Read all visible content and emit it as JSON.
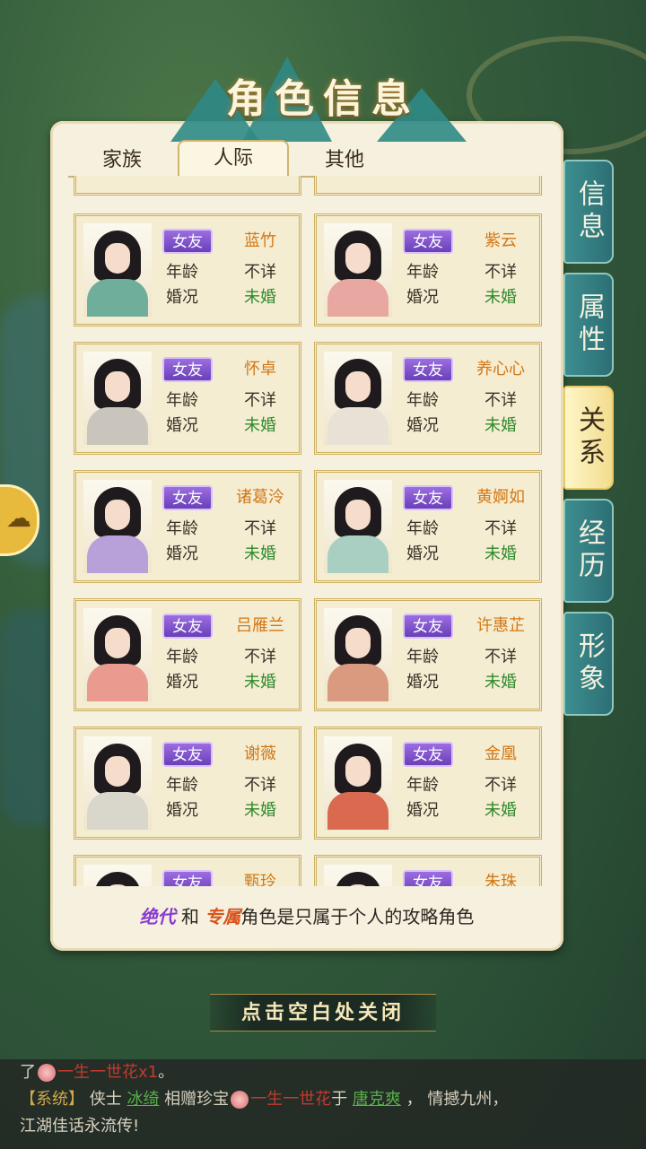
{
  "window": {
    "title": "角色信息"
  },
  "tabs": [
    {
      "label": "家族",
      "active": false
    },
    {
      "label": "人际",
      "active": true
    },
    {
      "label": "其他",
      "active": false
    }
  ],
  "side_tabs": [
    {
      "label": "信息",
      "active": false
    },
    {
      "label": "属性",
      "active": false
    },
    {
      "label": "关系",
      "active": true
    },
    {
      "label": "经历",
      "active": false
    },
    {
      "label": "形象",
      "active": false
    }
  ],
  "field_labels": {
    "age": "年龄",
    "marital": "婚况"
  },
  "characters": [
    {
      "relation": "女友",
      "name": "蓝竹",
      "age": "不详",
      "marital": "未婚",
      "outfit": "#6fae9a"
    },
    {
      "relation": "女友",
      "name": "紫云",
      "age": "不详",
      "marital": "未婚",
      "outfit": "#e9a7a2"
    },
    {
      "relation": "女友",
      "name": "怀卓",
      "age": "不详",
      "marital": "未婚",
      "outfit": "#c9c4bc"
    },
    {
      "relation": "女友",
      "name": "养心心",
      "age": "不详",
      "marital": "未婚",
      "outfit": "#e8e2d6"
    },
    {
      "relation": "女友",
      "name": "诸葛泠",
      "age": "不详",
      "marital": "未婚",
      "outfit": "#b7a1d8"
    },
    {
      "relation": "女友",
      "name": "黄婀如",
      "age": "不详",
      "marital": "未婚",
      "outfit": "#a8cfc2"
    },
    {
      "relation": "女友",
      "name": "吕雁兰",
      "age": "不详",
      "marital": "未婚",
      "outfit": "#e89b8e"
    },
    {
      "relation": "女友",
      "name": "许惠芷",
      "age": "不详",
      "marital": "未婚",
      "outfit": "#d99a80"
    },
    {
      "relation": "女友",
      "name": "谢薇",
      "age": "不详",
      "marital": "未婚",
      "outfit": "#d9d6cc"
    },
    {
      "relation": "女友",
      "name": "金凰",
      "age": "不详",
      "marital": "未婚",
      "outfit": "#d96a4f"
    },
    {
      "relation": "女友",
      "name": "甄玲",
      "age": "",
      "marital": "",
      "outfit": "#cccccc"
    },
    {
      "relation": "女友",
      "name": "朱珠",
      "age": "",
      "marital": "",
      "outfit": "#cccccc"
    }
  ],
  "footer_note": {
    "kw1": "绝代",
    "mid": " 和 ",
    "kw2": "专属",
    "rest": "角色是只属于个人的攻略角色"
  },
  "close_hint": "点击空白处关闭",
  "chat_log": {
    "line1_prefix": "了",
    "line1_item": "一生一世花x1",
    "line1_end": "。",
    "line2_tag": "【系统】",
    "line2_a": " 侠士 ",
    "line2_user": "冰绮",
    "line2_b": " 相赠珍宝",
    "line2_item": "一生一世花",
    "line2_c": "于 ",
    "line2_target": "唐克爽",
    "line2_d": " ， 情撼九州，",
    "line3": "江湖佳话永流传!"
  },
  "colors": {
    "accent_teal": "#2c6f74",
    "name_orange": "#d27716",
    "status_green": "#2f8a2c",
    "badge_purple": "#6a3fb8"
  }
}
